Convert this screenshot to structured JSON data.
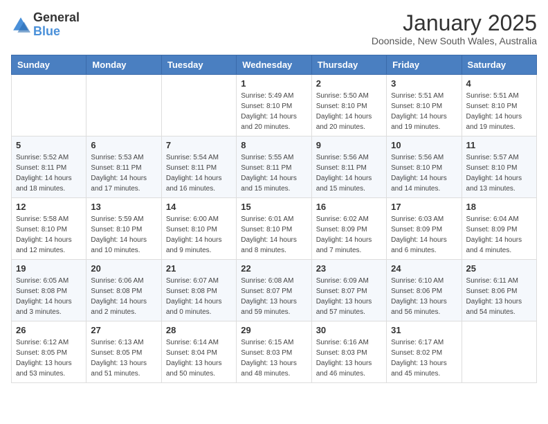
{
  "header": {
    "logo_general": "General",
    "logo_blue": "Blue",
    "month_title": "January 2025",
    "subtitle": "Doonside, New South Wales, Australia"
  },
  "weekdays": [
    "Sunday",
    "Monday",
    "Tuesday",
    "Wednesday",
    "Thursday",
    "Friday",
    "Saturday"
  ],
  "weeks": [
    [
      {
        "day": "",
        "info": ""
      },
      {
        "day": "",
        "info": ""
      },
      {
        "day": "",
        "info": ""
      },
      {
        "day": "1",
        "info": "Sunrise: 5:49 AM\nSunset: 8:10 PM\nDaylight: 14 hours\nand 20 minutes."
      },
      {
        "day": "2",
        "info": "Sunrise: 5:50 AM\nSunset: 8:10 PM\nDaylight: 14 hours\nand 20 minutes."
      },
      {
        "day": "3",
        "info": "Sunrise: 5:51 AM\nSunset: 8:10 PM\nDaylight: 14 hours\nand 19 minutes."
      },
      {
        "day": "4",
        "info": "Sunrise: 5:51 AM\nSunset: 8:10 PM\nDaylight: 14 hours\nand 19 minutes."
      }
    ],
    [
      {
        "day": "5",
        "info": "Sunrise: 5:52 AM\nSunset: 8:11 PM\nDaylight: 14 hours\nand 18 minutes."
      },
      {
        "day": "6",
        "info": "Sunrise: 5:53 AM\nSunset: 8:11 PM\nDaylight: 14 hours\nand 17 minutes."
      },
      {
        "day": "7",
        "info": "Sunrise: 5:54 AM\nSunset: 8:11 PM\nDaylight: 14 hours\nand 16 minutes."
      },
      {
        "day": "8",
        "info": "Sunrise: 5:55 AM\nSunset: 8:11 PM\nDaylight: 14 hours\nand 15 minutes."
      },
      {
        "day": "9",
        "info": "Sunrise: 5:56 AM\nSunset: 8:11 PM\nDaylight: 14 hours\nand 15 minutes."
      },
      {
        "day": "10",
        "info": "Sunrise: 5:56 AM\nSunset: 8:10 PM\nDaylight: 14 hours\nand 14 minutes."
      },
      {
        "day": "11",
        "info": "Sunrise: 5:57 AM\nSunset: 8:10 PM\nDaylight: 14 hours\nand 13 minutes."
      }
    ],
    [
      {
        "day": "12",
        "info": "Sunrise: 5:58 AM\nSunset: 8:10 PM\nDaylight: 14 hours\nand 12 minutes."
      },
      {
        "day": "13",
        "info": "Sunrise: 5:59 AM\nSunset: 8:10 PM\nDaylight: 14 hours\nand 10 minutes."
      },
      {
        "day": "14",
        "info": "Sunrise: 6:00 AM\nSunset: 8:10 PM\nDaylight: 14 hours\nand 9 minutes."
      },
      {
        "day": "15",
        "info": "Sunrise: 6:01 AM\nSunset: 8:10 PM\nDaylight: 14 hours\nand 8 minutes."
      },
      {
        "day": "16",
        "info": "Sunrise: 6:02 AM\nSunset: 8:09 PM\nDaylight: 14 hours\nand 7 minutes."
      },
      {
        "day": "17",
        "info": "Sunrise: 6:03 AM\nSunset: 8:09 PM\nDaylight: 14 hours\nand 6 minutes."
      },
      {
        "day": "18",
        "info": "Sunrise: 6:04 AM\nSunset: 8:09 PM\nDaylight: 14 hours\nand 4 minutes."
      }
    ],
    [
      {
        "day": "19",
        "info": "Sunrise: 6:05 AM\nSunset: 8:08 PM\nDaylight: 14 hours\nand 3 minutes."
      },
      {
        "day": "20",
        "info": "Sunrise: 6:06 AM\nSunset: 8:08 PM\nDaylight: 14 hours\nand 2 minutes."
      },
      {
        "day": "21",
        "info": "Sunrise: 6:07 AM\nSunset: 8:08 PM\nDaylight: 14 hours\nand 0 minutes."
      },
      {
        "day": "22",
        "info": "Sunrise: 6:08 AM\nSunset: 8:07 PM\nDaylight: 13 hours\nand 59 minutes."
      },
      {
        "day": "23",
        "info": "Sunrise: 6:09 AM\nSunset: 8:07 PM\nDaylight: 13 hours\nand 57 minutes."
      },
      {
        "day": "24",
        "info": "Sunrise: 6:10 AM\nSunset: 8:06 PM\nDaylight: 13 hours\nand 56 minutes."
      },
      {
        "day": "25",
        "info": "Sunrise: 6:11 AM\nSunset: 8:06 PM\nDaylight: 13 hours\nand 54 minutes."
      }
    ],
    [
      {
        "day": "26",
        "info": "Sunrise: 6:12 AM\nSunset: 8:05 PM\nDaylight: 13 hours\nand 53 minutes."
      },
      {
        "day": "27",
        "info": "Sunrise: 6:13 AM\nSunset: 8:05 PM\nDaylight: 13 hours\nand 51 minutes."
      },
      {
        "day": "28",
        "info": "Sunrise: 6:14 AM\nSunset: 8:04 PM\nDaylight: 13 hours\nand 50 minutes."
      },
      {
        "day": "29",
        "info": "Sunrise: 6:15 AM\nSunset: 8:03 PM\nDaylight: 13 hours\nand 48 minutes."
      },
      {
        "day": "30",
        "info": "Sunrise: 6:16 AM\nSunset: 8:03 PM\nDaylight: 13 hours\nand 46 minutes."
      },
      {
        "day": "31",
        "info": "Sunrise: 6:17 AM\nSunset: 8:02 PM\nDaylight: 13 hours\nand 45 minutes."
      },
      {
        "day": "",
        "info": ""
      }
    ]
  ]
}
